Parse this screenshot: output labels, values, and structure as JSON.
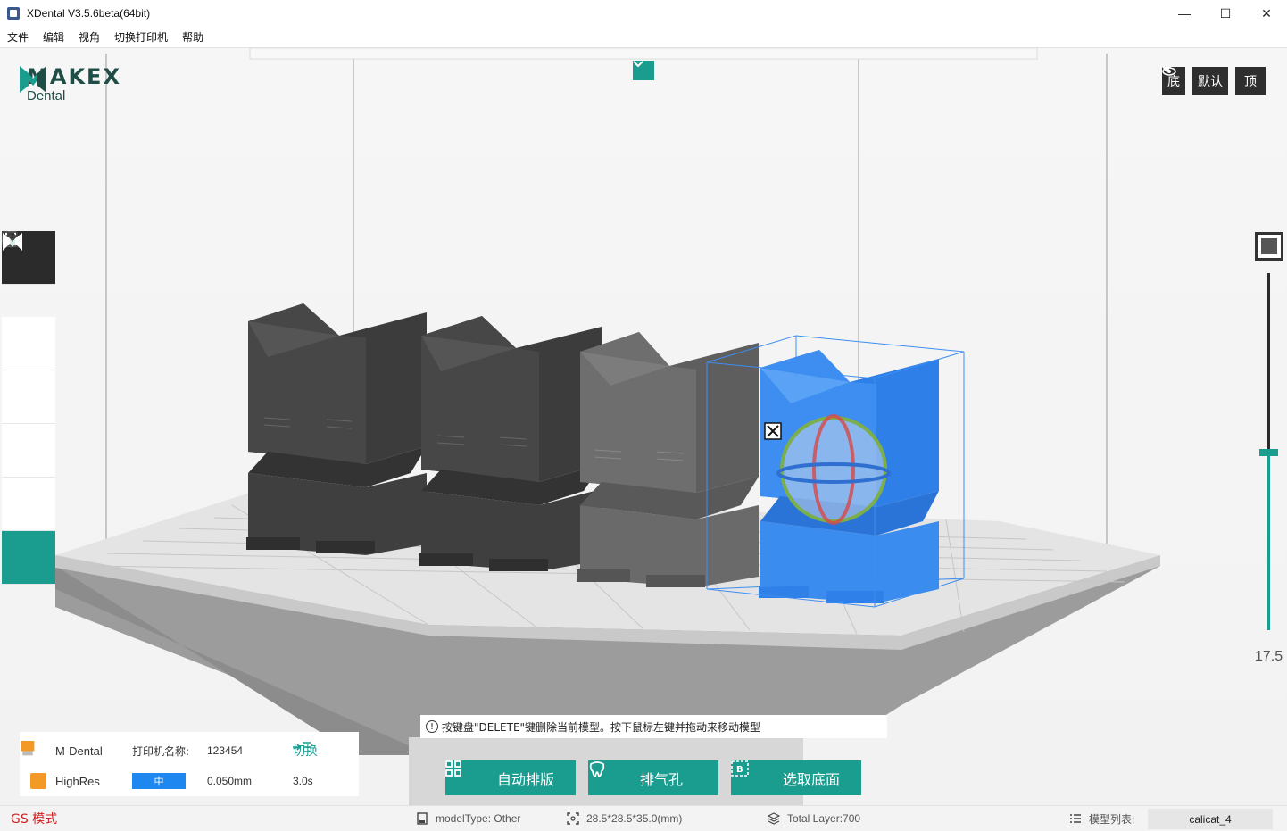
{
  "window": {
    "title": "XDental V3.5.6beta(64bit)",
    "controls": {
      "minimize": "—",
      "maximize": "☐",
      "close": "✕"
    }
  },
  "menu": {
    "items": [
      "文件",
      "编辑",
      "视角",
      "切换打印机",
      "帮助"
    ]
  },
  "logo": {
    "brand": "MAKEX",
    "product": "Dental",
    "color": "#1f4e47"
  },
  "view_buttons": {
    "bottom": "底",
    "default": "默认",
    "top": "顶"
  },
  "left_tools": [
    {
      "name": "print-icon"
    },
    {
      "name": "add-icon"
    },
    {
      "name": "layout-icon"
    },
    {
      "name": "rotate-icon"
    },
    {
      "name": "support-icon"
    },
    {
      "name": "makex-icon"
    }
  ],
  "slider": {
    "value": "17.5",
    "level_fraction": 0.5
  },
  "hint": {
    "text": "按键盘\"DELETE\"键删除当前模型。按下鼠标左键并拖动来移动模型"
  },
  "printer": {
    "material": "M-Dental",
    "printer_name_label": "打印机名称:",
    "printer_name": "123454",
    "switch_label": "切换",
    "profile": "HighRes",
    "quality": "中",
    "layer_height": "0.050mm",
    "exposure": "3.0s",
    "swatch_color": "#f29a25"
  },
  "actions": {
    "auto_layout": "自动排版",
    "vent_hole": "排气孔",
    "select_base": "选取底面"
  },
  "status": {
    "mode": "GS 模式",
    "model_type": "modelType: Other",
    "dimensions": "28.5*28.5*35.0(mm)",
    "total_layer": "Total Layer:700",
    "model_list_label": "模型列表:",
    "model_list_value": "calicat_4"
  },
  "colors": {
    "accent": "#1a9c8f",
    "selected_model": "#3d8ef0",
    "mode_text": "#cc2222"
  }
}
